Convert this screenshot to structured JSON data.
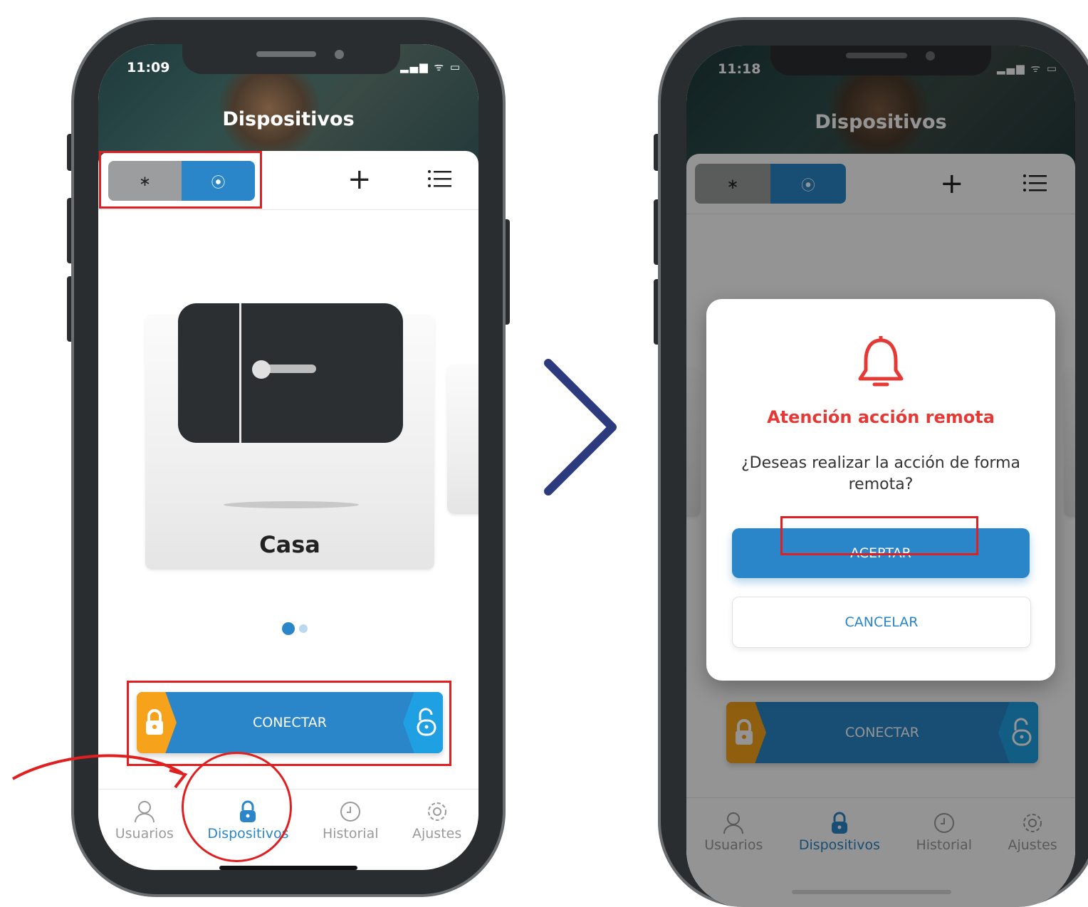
{
  "left_phone": {
    "time": "11:09",
    "status_icons": "▂▄▆ ᯤ ▭",
    "title": "Dispositivos",
    "toggle": {
      "bluetooth_icon": "bluetooth-icon",
      "remote_icon": "wifi-signal-icon",
      "bluetooth_glyph": "∗",
      "remote_glyph": "⦿"
    },
    "add_glyph": "+",
    "card": {
      "name": "Casa"
    },
    "connect_label": "CONECTAR",
    "tabs": [
      {
        "label": "Usuarios",
        "icon": "user-icon"
      },
      {
        "label": "Dispositivos",
        "icon": "lock-icon"
      },
      {
        "label": "Historial",
        "icon": "history-icon"
      },
      {
        "label": "Ajustes",
        "icon": "gear-icon"
      }
    ],
    "active_tab": "Dispositivos"
  },
  "right_phone": {
    "time": "11:18",
    "status_icons": "▂▄▆ ᯤ ▭",
    "title": "Dispositivos",
    "add_glyph": "+",
    "modal": {
      "icon": "bell-icon",
      "title": "Atención acción remota",
      "message": "¿Deseas realizar la acción de forma remota?",
      "accept_label": "ACEPTAR",
      "cancel_label": "CANCELAR"
    },
    "connect_label": "CONECTAR",
    "tabs": [
      {
        "label": "Usuarios",
        "icon": "user-icon"
      },
      {
        "label": "Dispositivos",
        "icon": "lock-icon"
      },
      {
        "label": "Historial",
        "icon": "history-icon"
      },
      {
        "label": "Ajustes",
        "icon": "gear-icon"
      }
    ]
  },
  "colors": {
    "accent_blue": "#2a86c8",
    "highlight_red": "#e02020",
    "arrow_navy": "#2c3a7e",
    "orange": "#f7a21b",
    "alert_red": "#e53935"
  }
}
